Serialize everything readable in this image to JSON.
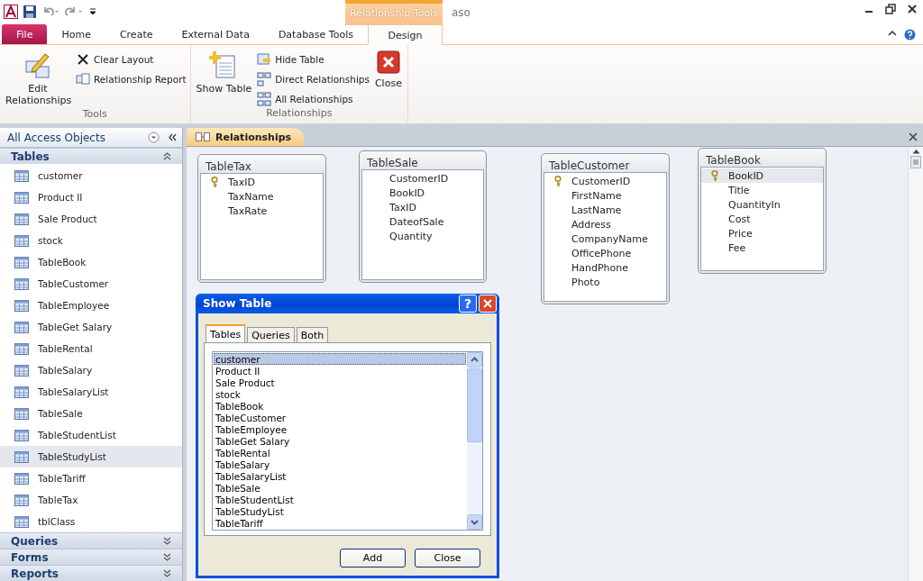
{
  "title_bar": {
    "title": "aso",
    "context_label": "Relationship Tools"
  },
  "ribbon_tabs": [
    {
      "label": "File",
      "kind": "file",
      "selected": false
    },
    {
      "label": "Home",
      "kind": "normal",
      "selected": false
    },
    {
      "label": "Create",
      "kind": "normal",
      "selected": false
    },
    {
      "label": "External Data",
      "kind": "normal",
      "selected": false
    },
    {
      "label": "Database Tools",
      "kind": "normal",
      "selected": false
    },
    {
      "label": "Design",
      "kind": "context",
      "selected": true
    }
  ],
  "ribbon_groups": [
    {
      "label": "Tools",
      "buttons": [
        {
          "label": "Edit Relationships",
          "kind": "large"
        },
        {
          "label": "Clear Layout",
          "kind": "small"
        },
        {
          "label": "Relationship Report",
          "kind": "small"
        }
      ]
    },
    {
      "label": "Relationships",
      "buttons": [
        {
          "label": "Show Table",
          "kind": "large"
        },
        {
          "label": "Hide Table",
          "kind": "small"
        },
        {
          "label": "Direct Relationships",
          "kind": "small"
        },
        {
          "label": "All Relationships",
          "kind": "small"
        },
        {
          "label": "Close",
          "kind": "large"
        }
      ]
    }
  ],
  "nav_pane": {
    "title": "All Access Objects",
    "sections": [
      {
        "label": "Tables",
        "expanded": true,
        "items": [
          {
            "label": "customer",
            "selected": false
          },
          {
            "label": "Product II",
            "selected": false
          },
          {
            "label": "Sale Product",
            "selected": false
          },
          {
            "label": "stock",
            "selected": false
          },
          {
            "label": "TableBook",
            "selected": false
          },
          {
            "label": "TableCustomer",
            "selected": false
          },
          {
            "label": "TableEmployee",
            "selected": false
          },
          {
            "label": "TableGet Salary",
            "selected": false
          },
          {
            "label": "TableRental",
            "selected": false
          },
          {
            "label": "TableSalary",
            "selected": false
          },
          {
            "label": "TableSalaryList",
            "selected": false
          },
          {
            "label": "TableSale",
            "selected": false
          },
          {
            "label": "TableStudentList",
            "selected": false
          },
          {
            "label": "TableStudyList",
            "selected": true
          },
          {
            "label": "TableTariff",
            "selected": false
          },
          {
            "label": "TableTax",
            "selected": false
          },
          {
            "label": "tblClass",
            "selected": false
          }
        ]
      },
      {
        "label": "Queries",
        "expanded": false
      },
      {
        "label": "Forms",
        "expanded": false
      },
      {
        "label": "Reports",
        "expanded": false
      }
    ]
  },
  "document_tab": {
    "label": "Relationships"
  },
  "tables": [
    {
      "title": "TableTax",
      "fields": [
        {
          "name": "TaxID",
          "primary_key": true,
          "selected": false
        },
        {
          "name": "TaxName",
          "primary_key": false,
          "selected": false
        },
        {
          "name": "TaxRate",
          "primary_key": false,
          "selected": false
        }
      ]
    },
    {
      "title": "TableSale",
      "fields": [
        {
          "name": "CustomerID",
          "primary_key": false,
          "selected": false
        },
        {
          "name": "BookID",
          "primary_key": false,
          "selected": false
        },
        {
          "name": "TaxID",
          "primary_key": false,
          "selected": false
        },
        {
          "name": "DateofSale",
          "primary_key": false,
          "selected": false
        },
        {
          "name": "Quantity",
          "primary_key": false,
          "selected": false
        }
      ]
    },
    {
      "title": "TableCustomer",
      "fields": [
        {
          "name": "CustomerID",
          "primary_key": true,
          "selected": false
        },
        {
          "name": "FirstName",
          "primary_key": false,
          "selected": false
        },
        {
          "name": "LastName",
          "primary_key": false,
          "selected": false
        },
        {
          "name": "Address",
          "primary_key": false,
          "selected": false
        },
        {
          "name": "CompanyName",
          "primary_key": false,
          "selected": false
        },
        {
          "name": "OfficePhone",
          "primary_key": false,
          "selected": false
        },
        {
          "name": "HandPhone",
          "primary_key": false,
          "selected": false
        },
        {
          "name": "Photo",
          "primary_key": false,
          "selected": false
        }
      ]
    },
    {
      "title": "TableBook",
      "fields": [
        {
          "name": "BookID",
          "primary_key": true,
          "selected": true
        },
        {
          "name": "Title",
          "primary_key": false,
          "selected": false
        },
        {
          "name": "QuantityIn",
          "primary_key": false,
          "selected": false
        },
        {
          "name": "Cost",
          "primary_key": false,
          "selected": false
        },
        {
          "name": "Price",
          "primary_key": false,
          "selected": false
        },
        {
          "name": "Fee",
          "primary_key": false,
          "selected": false
        }
      ]
    }
  ],
  "dialog": {
    "title": "Show Table",
    "help": "?",
    "tabs": [
      {
        "label": "Tables",
        "selected": true
      },
      {
        "label": "Queries",
        "selected": false
      },
      {
        "label": "Both",
        "selected": false
      }
    ],
    "items": [
      {
        "label": "customer",
        "selected": true
      },
      {
        "label": "Product II",
        "selected": false
      },
      {
        "label": "Sale Product",
        "selected": false
      },
      {
        "label": "stock",
        "selected": false
      },
      {
        "label": "TableBook",
        "selected": false
      },
      {
        "label": "TableCustomer",
        "selected": false
      },
      {
        "label": "TableEmployee",
        "selected": false
      },
      {
        "label": "TableGet Salary",
        "selected": false
      },
      {
        "label": "TableRental",
        "selected": false
      },
      {
        "label": "TableSalary",
        "selected": false
      },
      {
        "label": "TableSalaryList",
        "selected": false
      },
      {
        "label": "TableSale",
        "selected": false
      },
      {
        "label": "TableStudentList",
        "selected": false
      },
      {
        "label": "TableStudyList",
        "selected": false
      },
      {
        "label": "TableTariff",
        "selected": false
      }
    ],
    "buttons": [
      {
        "label": "Add"
      },
      {
        "label": "Close"
      }
    ]
  }
}
